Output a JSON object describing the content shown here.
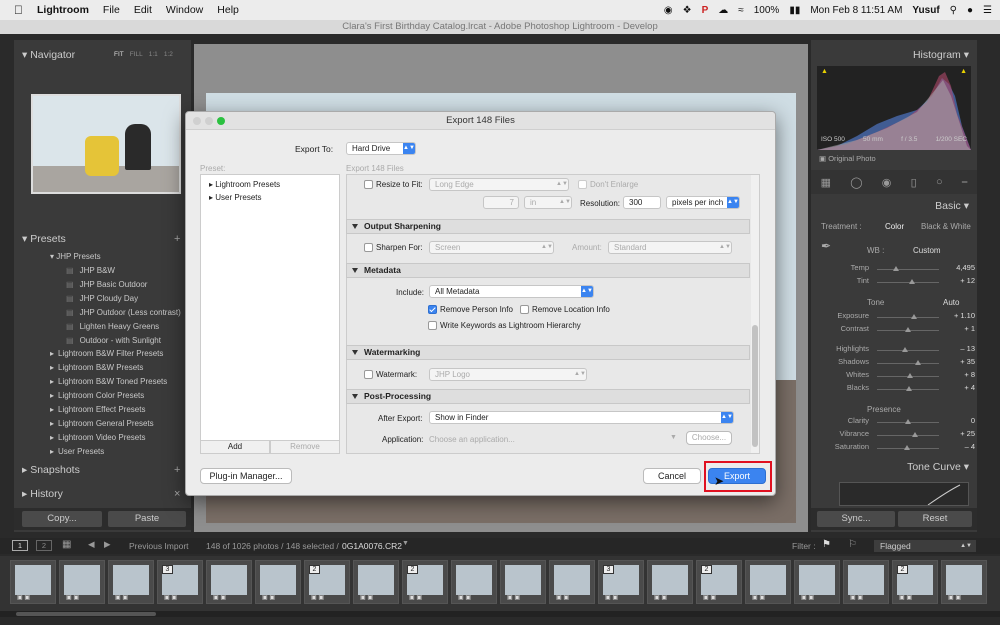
{
  "menubar": {
    "app": "Lightroom",
    "menus": [
      "File",
      "Edit",
      "Window",
      "Help"
    ],
    "battery": "100%",
    "datetime": "Mon Feb 8  11:51 AM",
    "user": "Yusuf"
  },
  "window_title": "Clara's First Birthday Catalog.lrcat - Adobe Photoshop Lightroom - Develop",
  "left_panel": {
    "navigator": {
      "title": "Navigator",
      "zoom_options": [
        "FIT",
        "FILL",
        "1:1",
        "1:2"
      ]
    },
    "presets": {
      "title": "Presets",
      "open_group": "JHP Presets",
      "open_items": [
        "JHP B&W",
        "JHP Basic Outdoor",
        "JHP Cloudy Day",
        "JHP Outdoor (Less contrast)",
        "Lighten Heavy Greens",
        "Outdoor - with Sunlight"
      ],
      "groups": [
        "Lightroom B&W Filter Presets",
        "Lightroom B&W Presets",
        "Lightroom B&W Toned Presets",
        "Lightroom Color Presets",
        "Lightroom Effect Presets",
        "Lightroom General Presets",
        "Lightroom Video Presets",
        "User Presets"
      ]
    },
    "snapshots": "Snapshots",
    "history": "History",
    "copy_button": "Copy...",
    "paste_button": "Paste"
  },
  "right_panel": {
    "histogram": {
      "title": "Histogram",
      "iso": "ISO 500",
      "focal": "50 mm",
      "aperture": "f / 3.5",
      "shutter": "1/200 SEC",
      "original": "Original Photo"
    },
    "basic": {
      "title": "Basic",
      "treatment_label": "Treatment :",
      "treatment_color": "Color",
      "treatment_bw": "Black & White",
      "wb_label": "WB :",
      "wb_value": "Custom",
      "temp": {
        "label": "Temp",
        "value": "4,495",
        "level": 0.3
      },
      "tint": {
        "label": "Tint",
        "value": "+ 12",
        "level": 0.56
      },
      "tone_label": "Tone",
      "auto": "Auto",
      "tone": [
        {
          "label": "Exposure",
          "value": "+ 1.10",
          "level": 0.6
        },
        {
          "label": "Contrast",
          "value": "+ 1",
          "level": 0.5
        }
      ],
      "tone2": [
        {
          "label": "Highlights",
          "value": "– 13",
          "level": 0.45
        },
        {
          "label": "Shadows",
          "value": "+ 35",
          "level": 0.66
        },
        {
          "label": "Whites",
          "value": "+ 8",
          "level": 0.54
        },
        {
          "label": "Blacks",
          "value": "+ 4",
          "level": 0.52
        }
      ],
      "presence_label": "Presence",
      "presence": [
        {
          "label": "Clarity",
          "value": "0",
          "level": 0.5
        },
        {
          "label": "Vibrance",
          "value": "+ 25",
          "level": 0.62
        },
        {
          "label": "Saturation",
          "value": "– 4",
          "level": 0.48
        }
      ]
    },
    "tone_curve": "Tone Curve",
    "sync_button": "Sync...",
    "reset_button": "Reset"
  },
  "dialog": {
    "title": "Export 148 Files",
    "export_to_label": "Export To:",
    "export_to_value": "Hard Drive",
    "preset_label": "Preset:",
    "files_label": "Export 148 Files",
    "preset_tree": [
      "Lightroom Presets",
      "User Presets"
    ],
    "add_button": "Add",
    "remove_button": "Remove",
    "resize_label": "Resize to Fit:",
    "resize_value": "Long Edge",
    "dont_enlarge": "Don't Enlarge",
    "size_value": "7",
    "size_unit": "in",
    "resolution_label": "Resolution:",
    "resolution_value": "300",
    "resolution_unit": "pixels per inch",
    "output_sharpening": "Output Sharpening",
    "sharpen_for_label": "Sharpen For:",
    "sharpen_for_value": "Screen",
    "amount_label": "Amount:",
    "amount_value": "Standard",
    "metadata": "Metadata",
    "include_label": "Include:",
    "include_value": "All Metadata",
    "remove_person": "Remove Person Info",
    "remove_location": "Remove Location Info",
    "write_keywords": "Write Keywords as Lightroom Hierarchy",
    "watermarking": "Watermarking",
    "watermark_label": "Watermark:",
    "watermark_value": "JHP Logo",
    "post_processing": "Post-Processing",
    "after_export_label": "After Export:",
    "after_export_value": "Show in Finder",
    "application_label": "Application:",
    "application_value": "Choose an application...",
    "choose_button": "Choose...",
    "plugin_button": "Plug-in Manager...",
    "cancel_button": "Cancel",
    "export_button": "Export"
  },
  "filmstrip_bar": {
    "views": [
      "1",
      "2"
    ],
    "source": "Previous Import",
    "count": "148 of 1026 photos / 148 selected /",
    "filename": "0G1A0076.CR2",
    "filter_label": "Filter :",
    "filter_value": "Flagged"
  },
  "thumb_badges": [
    "",
    "",
    "",
    "3",
    "",
    "",
    "2",
    "",
    "2",
    "",
    "",
    "",
    "3",
    "",
    "2",
    "",
    "",
    "",
    "2",
    ""
  ]
}
